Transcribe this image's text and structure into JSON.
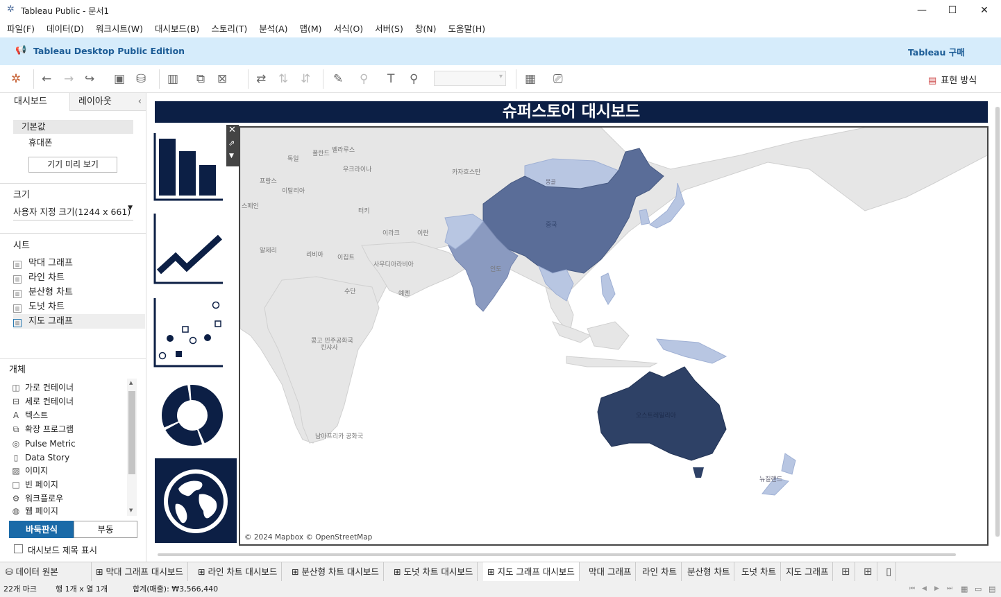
{
  "window": {
    "title": "Tableau Public - 문서1"
  },
  "menu": [
    "파일(F)",
    "데이터(D)",
    "워크시트(W)",
    "대시보드(B)",
    "스토리(T)",
    "분석(A)",
    "맵(M)",
    "서식(O)",
    "서버(S)",
    "창(N)",
    "도움말(H)"
  ],
  "banner": {
    "text": "Tableau Desktop Public Edition",
    "buy": "Tableau 구매"
  },
  "toolbar": {
    "show_me": "표현 방식"
  },
  "sidebar": {
    "tabs": [
      "대시보드",
      "레이아웃"
    ],
    "devices": [
      "기본값",
      "휴대폰"
    ],
    "preview_button": "기기 미리 보기",
    "size_label": "크기",
    "size_value": "사용자 지정 크기(1244 x 661)",
    "sheets_label": "시트",
    "sheets": [
      "막대 그래프",
      "라인 차트",
      "분산형 차트",
      "도넛 차트",
      "지도 그래프"
    ],
    "objects_label": "개체",
    "objects": [
      "가로 컨테이너",
      "세로 컨테이너",
      "텍스트",
      "확장 프로그램",
      "Pulse Metric",
      "Data Story",
      "이미지",
      "빈 페이지",
      "워크플로우",
      "웹 페이지"
    ],
    "tiled": "바둑판식",
    "floating": "부동",
    "show_title": "대시보드 제목 표시"
  },
  "dashboard": {
    "title": "슈퍼스토어 대시보드",
    "map_attribution": "© 2024 Mapbox © OpenStreetMap",
    "map_labels": [
      "폴란드",
      "벨라루스",
      "독일",
      "우크라이나",
      "프랑스",
      "이탈리아",
      "스페인",
      "터키",
      "카자흐스탄",
      "몽골",
      "중국",
      "이라크",
      "이란",
      "알제리",
      "리비아",
      "이집트",
      "사우디아라비아",
      "수단",
      "예멘",
      "인도",
      "콩고 민주공화국",
      "킨샤사",
      "남아프리카 공화국",
      "오스트레일리아",
      "뉴질랜드"
    ]
  },
  "tabs": [
    "데이터 원본",
    "막대 그래프 대시보드",
    "라인 차트 대시보드",
    "분산형 차트 대시보드",
    "도넛 차트 대시보드",
    "지도 그래프 대시보드",
    "막대 그래프",
    "라인 차트",
    "분산형 차트",
    "도넛 차트",
    "지도 그래프"
  ],
  "status": {
    "marks": "22개 마크",
    "rows_cols": "행 1개 x 열 1개",
    "sum": "합계(매출): ₩3,566,440"
  },
  "colors": {
    "navy": "#0c1f45",
    "banner": "#d6ecfb",
    "china": "#5a6d98",
    "australia": "#2e4166",
    "india": "#8a9ac0",
    "light_region": "#b8c6e2",
    "land": "#e6e6e6"
  }
}
